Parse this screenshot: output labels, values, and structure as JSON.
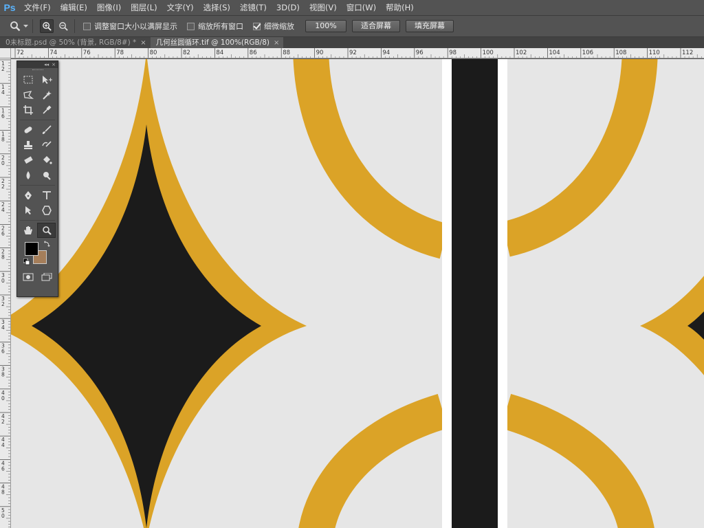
{
  "app": {
    "logo": "Ps"
  },
  "menu": [
    "文件(F)",
    "编辑(E)",
    "图像(I)",
    "图层(L)",
    "文字(Y)",
    "选择(S)",
    "滤镜(T)",
    "3D(D)",
    "视图(V)",
    "窗口(W)",
    "帮助(H)"
  ],
  "options": {
    "tool_icon": "zoom-icon",
    "zoom_in_icon": "zoom-in-icon",
    "zoom_out_icon": "zoom-out-icon",
    "resize_windows_label": "调整窗口大小以满屏显示",
    "resize_windows_checked": false,
    "zoom_all_label": "缩放所有窗口",
    "zoom_all_checked": false,
    "scrubby_label": "细微缩放",
    "scrubby_checked": true,
    "btn_100": "100%",
    "btn_fit": "适合屏幕",
    "btn_fill": "填充屏幕"
  },
  "tabs": [
    {
      "label": "0未标题.psd @ 50% (背景, RGB/8#) *",
      "active": false
    },
    {
      "label": "几何丝圆循环.tif @ 100%(RGB/8)",
      "active": true
    }
  ],
  "ruler": {
    "top": [
      "72",
      "74",
      "76",
      "78",
      "80",
      "82",
      "84",
      "86",
      "88",
      "90",
      "92",
      "94",
      "96",
      "98",
      "100",
      "102",
      "104",
      "106",
      "108",
      "110",
      "112"
    ],
    "left": [
      "1\n2",
      "1\n4",
      "1\n6",
      "1\n8",
      "2\n0",
      "2\n2",
      "2\n4",
      "2\n6",
      "2\n8",
      "3\n0",
      "3\n2",
      "3\n4",
      "3\n6",
      "3\n8",
      "4\n0",
      "4\n2",
      "4\n4",
      "4\n6",
      "4\n8",
      "5\n0"
    ]
  },
  "toolbox": {
    "rows": [
      [
        "marquee-icon",
        "move-icon"
      ],
      [
        "lasso-icon",
        "magic-wand-icon"
      ],
      [
        "crop-icon",
        "eyedropper-icon"
      ],
      [
        "healing-brush-icon",
        "brush-icon"
      ],
      [
        "clone-stamp-icon",
        "history-brush-icon"
      ],
      [
        "eraser-icon",
        "paint-bucket-icon"
      ],
      [
        "blur-icon",
        "dodge-icon"
      ],
      [
        "pen-icon",
        "type-icon"
      ],
      [
        "path-selection-icon",
        "shape-icon"
      ],
      [
        "hand-icon",
        "zoom-tool-icon"
      ]
    ],
    "selected": "zoom-tool-icon",
    "fg_color": "#000000",
    "bg_color": "#a57e5a"
  },
  "colors": {
    "gold": "#dba327",
    "dark": "#1b1b1b",
    "paper": "#e6e6e6",
    "white": "#ffffff"
  }
}
